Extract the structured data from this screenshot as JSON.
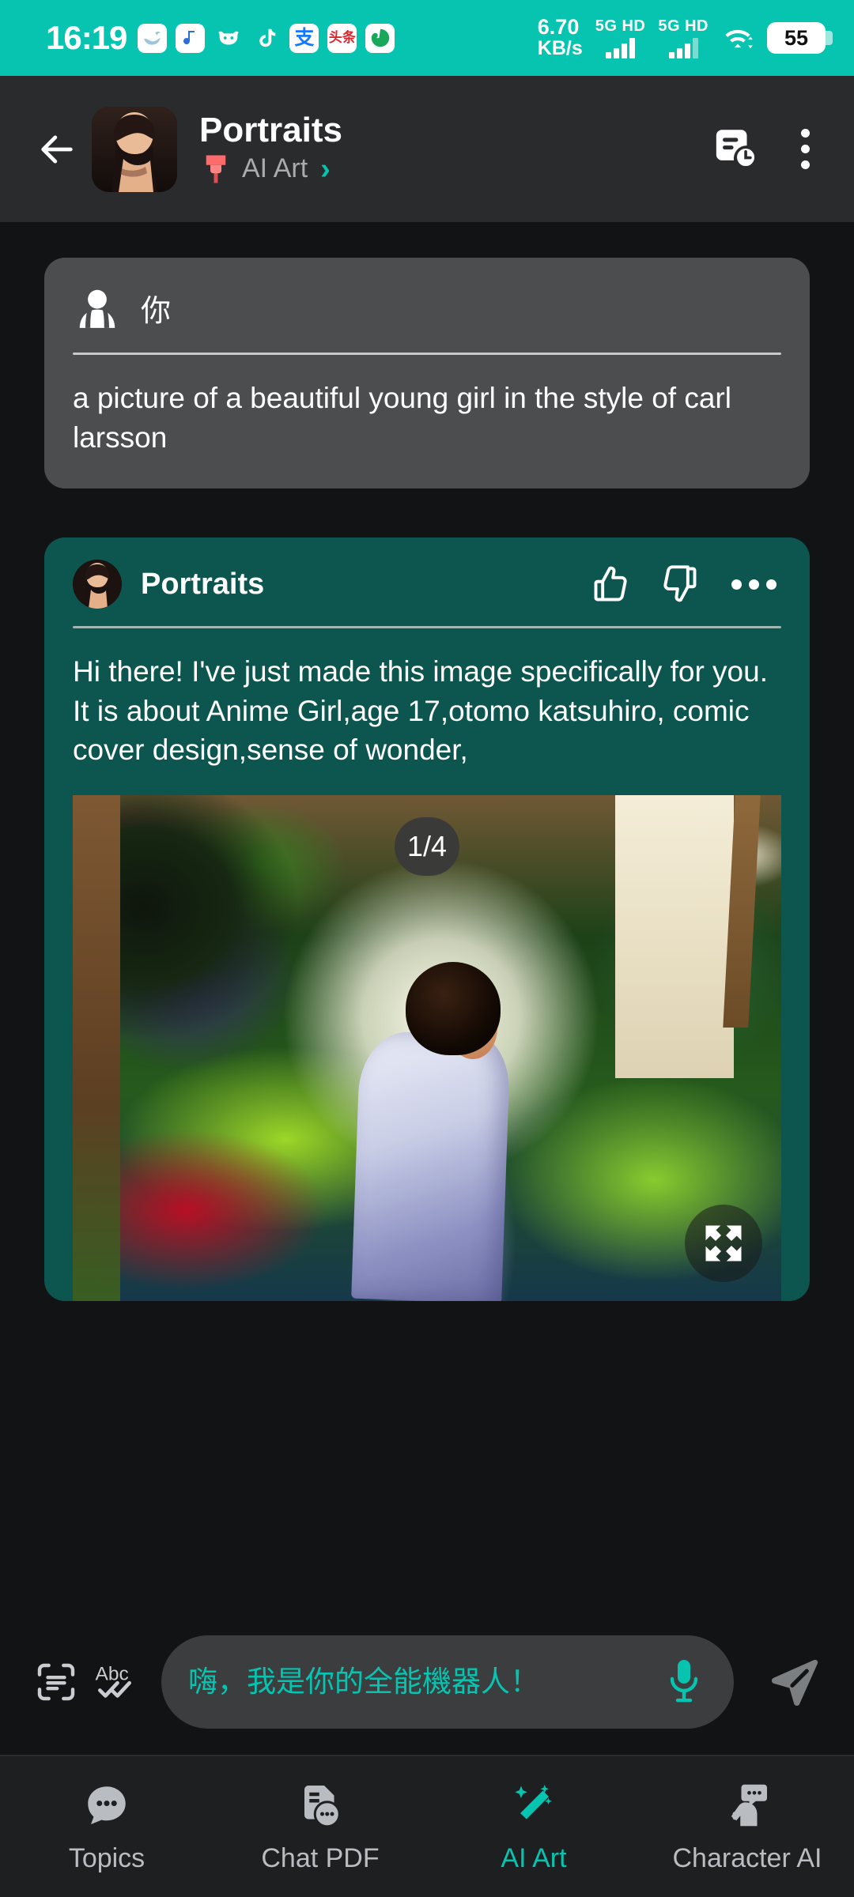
{
  "status_bar": {
    "time": "16:19",
    "app_icons": [
      "whale-icon",
      "douyin-note-icon",
      "cow-mask-icon",
      "tiktok-icon",
      "alipay-icon",
      "toutiao-icon",
      "uc-browser-icon"
    ],
    "network_speed_value": "6.70",
    "network_speed_unit": "KB/s",
    "sim1_label": "5G HD",
    "sim2_label": "5G HD",
    "wifi_icon": "wifi-icon",
    "battery_percent": "55",
    "bar_color": "#06c4b0"
  },
  "header": {
    "back_icon": "arrow-left-icon",
    "avatar": "portraits-avatar",
    "title": "Portraits",
    "subtitle_icon": "paint-brush-icon",
    "subtitle": "AI Art",
    "subtitle_chevron": "chevron-right-icon",
    "history_icon": "chat-history-icon",
    "menu_icon": "more-vertical-icon",
    "accent": "#06c4b0"
  },
  "chat": {
    "user_message": {
      "avatar_icon": "user-avatar-icon",
      "sender": "你",
      "text": "a picture of a beautiful young girl in the style of carl larsson"
    },
    "bot_message": {
      "avatar": "portraits-avatar",
      "sender": "Portraits",
      "like_icon": "thumbs-up-icon",
      "dislike_icon": "thumbs-down-icon",
      "more_icon": "more-horizontal-icon",
      "text": "Hi there! I've just made this image specifically for you. It is about Anime Girl,age 17,otomo katsuhiro, comic cover design,sense of wonder,",
      "image_counter": "1/4",
      "expand_icon": "fullscreen-expand-icon",
      "bubble_color": "#0d5650"
    }
  },
  "input_bar": {
    "scan_icon": "scan-text-icon",
    "spellcheck_icon": "abc-check-icon",
    "placeholder": "嗨，我是你的全能機器人！",
    "mic_icon": "microphone-icon",
    "send_icon": "send-icon",
    "placeholder_color": "#06c4b0"
  },
  "bottom_nav": {
    "items": [
      {
        "label": "Topics",
        "icon": "chat-bubble-icon",
        "active": false
      },
      {
        "label": "Chat PDF",
        "icon": "pdf-chat-icon",
        "active": false
      },
      {
        "label": "AI Art",
        "icon": "magic-wand-icon",
        "active": true
      },
      {
        "label": "Character AI",
        "icon": "character-chat-icon",
        "active": false
      }
    ],
    "active_color": "#06c4b0",
    "inactive_color": "#b9bcc0"
  }
}
